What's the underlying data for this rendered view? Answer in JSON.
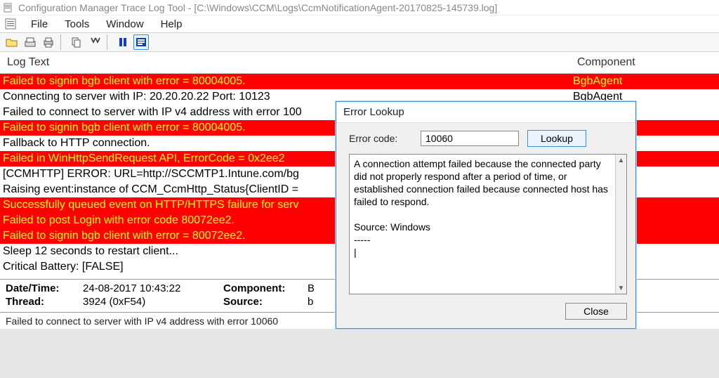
{
  "window": {
    "title": "Configuration Manager Trace Log Tool - [C:\\Windows\\CCM\\Logs\\CcmNotificationAgent-20170825-145739.log]"
  },
  "menu": {
    "file": "File",
    "tools": "Tools",
    "window": "Window",
    "help": "Help"
  },
  "columns": {
    "text": "Log Text",
    "component": "Component"
  },
  "rows": [
    {
      "text": "Failed to signin bgb client with error = 80004005.",
      "component": "BgbAgent",
      "sev": "error"
    },
    {
      "text": "Connecting to server with IP: 20.20.20.22 Port: 10123",
      "component": "BgbAgent",
      "sev": "normal"
    },
    {
      "text": "Failed to connect to server with IP v4 address with error 100",
      "component": "",
      "sev": "normal"
    },
    {
      "text": "Failed to signin bgb client with error = 80004005.",
      "component": "",
      "sev": "error"
    },
    {
      "text": "Fallback to HTTP connection.",
      "component": "",
      "sev": "normal"
    },
    {
      "text": "Failed in WinHttpSendRequest API, ErrorCode = 0x2ee2",
      "component": "",
      "sev": "error"
    },
    {
      "text": "[CCMHTTP] ERROR: URL=http://SCCMTP1.Intune.com/bg",
      "component": "",
      "sev": "normal"
    },
    {
      "text": "Raising event:instance of CCM_CcmHttp_Status{ClientID =",
      "component": "",
      "sev": "normal"
    },
    {
      "text": "Successfully queued event on HTTP/HTTPS failure for serv",
      "component": "",
      "sev": "error"
    },
    {
      "text": "Failed to post Login with error code 80072ee2.",
      "component": "",
      "sev": "error"
    },
    {
      "text": "Failed to signin bgb client with error = 80072ee2.",
      "component": "",
      "sev": "error"
    },
    {
      "text": "Sleep 12 seconds to restart client...",
      "component": "",
      "sev": "normal"
    },
    {
      "text": "Critical Battery: [FALSE]",
      "component": "",
      "sev": "normal"
    }
  ],
  "details": {
    "datetime_label": "Date/Time:",
    "datetime_value": "24-08-2017 10:43:22",
    "thread_label": "Thread:",
    "thread_value": "3924 (0xF54)",
    "component_label": "Component:",
    "component_value": "B",
    "source_label": "Source:",
    "source_value": "b"
  },
  "statusbar": "Failed to connect to server with IP v4 address with error 10060",
  "dialog": {
    "title": "Error Lookup",
    "label": "Error code:",
    "code": "10060",
    "lookup": "Lookup",
    "body": "A connection attempt failed because the connected party did not properly respond after a period of time, or established connection failed because connected host has failed to respond.\n\nSource: Windows\n-----\n",
    "close": "Close"
  }
}
